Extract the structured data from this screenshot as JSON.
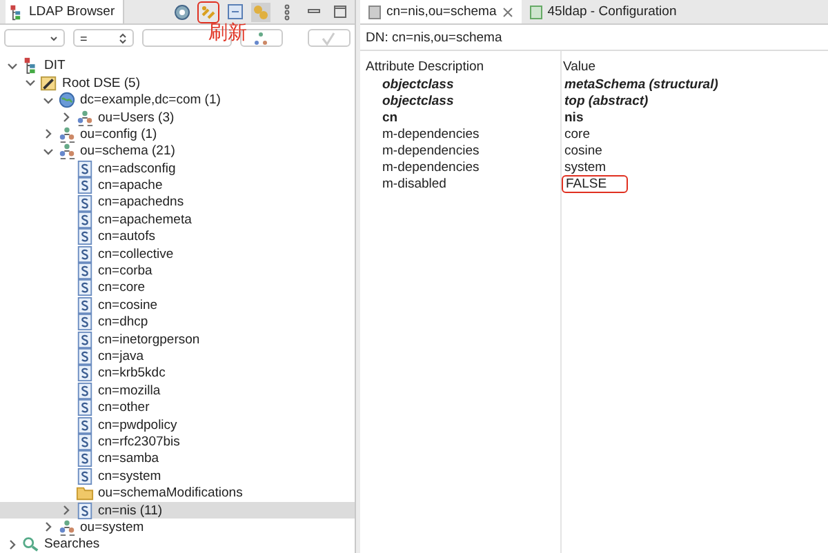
{
  "browser": {
    "title": "LDAP Browser",
    "refresh_note": "刷新",
    "refresh_highlighted": true,
    "filter": {
      "operator": "="
    },
    "tree": [
      {
        "label": "DIT",
        "kind": "dit",
        "expanded": true,
        "selected": false,
        "children": [
          {
            "label": "Root DSE (5)",
            "kind": "rootdse",
            "expanded": true,
            "selected": false,
            "children": [
              {
                "label": "dc=example,dc=com (1)",
                "kind": "domain",
                "expanded": true,
                "selected": false,
                "children": [
                  {
                    "label": "ou=Users (3)",
                    "kind": "ou",
                    "expanded": false,
                    "selected": false
                  }
                ]
              },
              {
                "label": "ou=config (1)",
                "kind": "ou",
                "expanded": false,
                "selected": false
              },
              {
                "label": "ou=schema (21)",
                "kind": "ou",
                "expanded": true,
                "selected": false,
                "children": [
                  {
                    "label": "cn=adsconfig",
                    "kind": "schema",
                    "selected": false
                  },
                  {
                    "label": "cn=apache",
                    "kind": "schema",
                    "selected": false
                  },
                  {
                    "label": "cn=apachedns",
                    "kind": "schema",
                    "selected": false
                  },
                  {
                    "label": "cn=apachemeta",
                    "kind": "schema",
                    "selected": false
                  },
                  {
                    "label": "cn=autofs",
                    "kind": "schema",
                    "selected": false
                  },
                  {
                    "label": "cn=collective",
                    "kind": "schema",
                    "selected": false
                  },
                  {
                    "label": "cn=corba",
                    "kind": "schema",
                    "selected": false
                  },
                  {
                    "label": "cn=core",
                    "kind": "schema",
                    "selected": false
                  },
                  {
                    "label": "cn=cosine",
                    "kind": "schema",
                    "selected": false
                  },
                  {
                    "label": "cn=dhcp",
                    "kind": "schema",
                    "selected": false
                  },
                  {
                    "label": "cn=inetorgperson",
                    "kind": "schema",
                    "selected": false
                  },
                  {
                    "label": "cn=java",
                    "kind": "schema",
                    "selected": false
                  },
                  {
                    "label": "cn=krb5kdc",
                    "kind": "schema",
                    "selected": false
                  },
                  {
                    "label": "cn=mozilla",
                    "kind": "schema",
                    "selected": false
                  },
                  {
                    "label": "cn=other",
                    "kind": "schema",
                    "selected": false
                  },
                  {
                    "label": "cn=pwdpolicy",
                    "kind": "schema",
                    "selected": false
                  },
                  {
                    "label": "cn=rfc2307bis",
                    "kind": "schema",
                    "selected": false
                  },
                  {
                    "label": "cn=samba",
                    "kind": "schema",
                    "selected": false
                  },
                  {
                    "label": "cn=system",
                    "kind": "schema",
                    "selected": false
                  },
                  {
                    "label": "ou=schemaModifications",
                    "kind": "folder",
                    "selected": false
                  },
                  {
                    "label": "cn=nis (11)",
                    "kind": "schema",
                    "expanded": false,
                    "selected": true
                  }
                ]
              },
              {
                "label": "ou=system",
                "kind": "ou",
                "expanded": false,
                "selected": false
              }
            ]
          }
        ]
      },
      {
        "label": "Searches",
        "kind": "searches",
        "expanded": false,
        "selected": false
      }
    ]
  },
  "editor": {
    "tabs": [
      {
        "label": "cn=nis,ou=schema",
        "selected": true
      },
      {
        "label": "45ldap - Configuration",
        "selected": false
      }
    ],
    "dn": "DN: cn=nis,ou=schema",
    "table": {
      "columns": [
        "Attribute Description",
        "Value"
      ],
      "rows": [
        {
          "attribute": "objectclass",
          "value": "metaSchema (structural)",
          "kind": "objectclass",
          "highlighted": false
        },
        {
          "attribute": "objectclass",
          "value": "top (abstract)",
          "kind": "objectclass",
          "highlighted": false
        },
        {
          "attribute": "cn",
          "value": "nis",
          "kind": "rdn",
          "highlighted": false
        },
        {
          "attribute": "m-dependencies",
          "value": "core",
          "kind": "attribute",
          "highlighted": false
        },
        {
          "attribute": "m-dependencies",
          "value": "cosine",
          "kind": "attribute",
          "highlighted": false
        },
        {
          "attribute": "m-dependencies",
          "value": "system",
          "kind": "attribute",
          "highlighted": false
        },
        {
          "attribute": "m-disabled",
          "value": "FALSE",
          "kind": "attribute",
          "highlighted": true
        }
      ]
    }
  }
}
